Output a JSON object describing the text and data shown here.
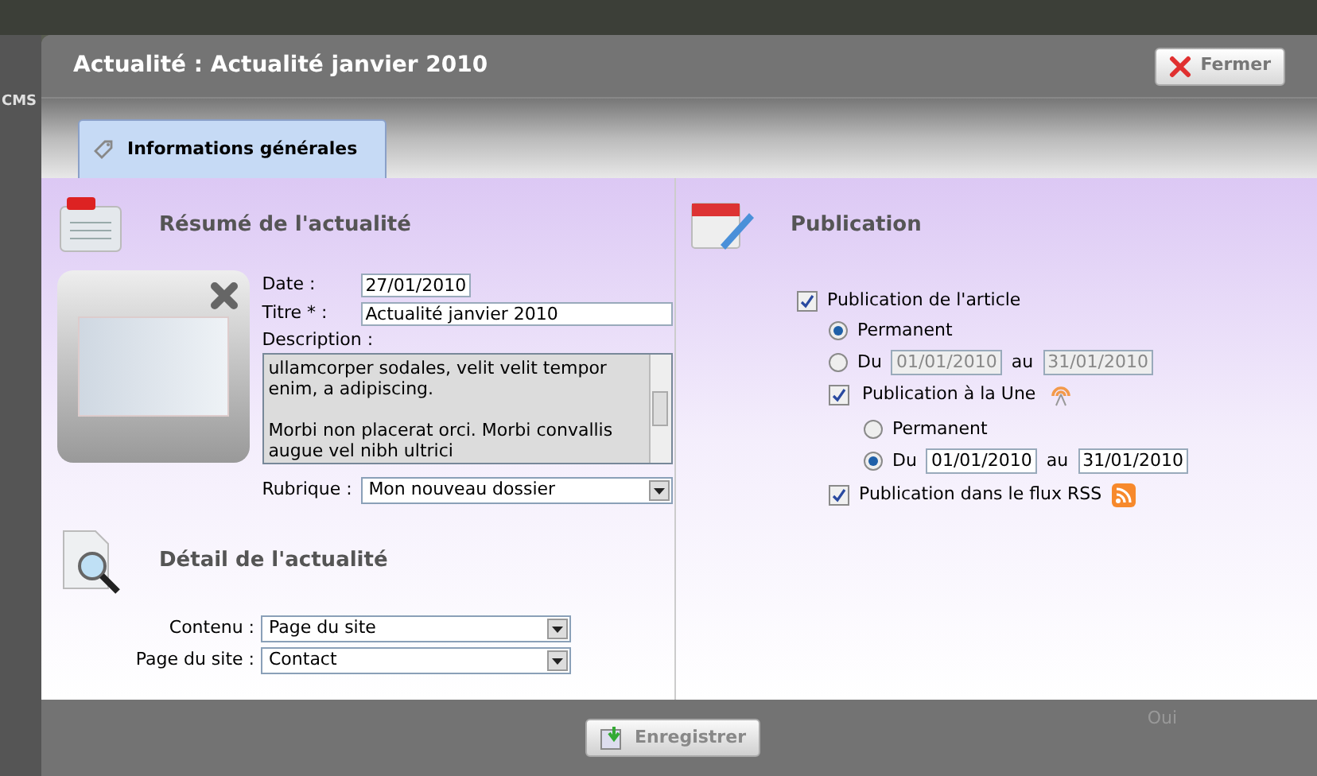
{
  "background": {
    "section_label": "CMS",
    "cell_text": "Oui"
  },
  "dialog": {
    "title": "Actualité : Actualité janvier 2010",
    "close_button": "Fermer"
  },
  "tabs": [
    {
      "label": "Informations générales",
      "selected": true
    }
  ],
  "summary": {
    "heading": "Résumé de l'actualité",
    "date": {
      "label": "Date :",
      "value": "27/01/2010"
    },
    "title": {
      "label": "Titre * :",
      "value": "Actualité janvier 2010"
    },
    "description": {
      "label": "Description :",
      "paragraphs": [
        [
          "ullamcorper sodales, velit velit tempor",
          "enim, a adipiscing."
        ],
        [
          "Morbi non placerat orci. Morbi convallis",
          "augue vel nibh ultrici"
        ]
      ]
    },
    "rubrique": {
      "label": "Rubrique :",
      "value": "Mon nouveau dossier"
    }
  },
  "detail": {
    "heading": "Détail de l'actualité",
    "fields": [
      {
        "label": "Contenu :",
        "value": "Page du site"
      },
      {
        "label": "Page du site :",
        "value": "Contact"
      }
    ]
  },
  "publication": {
    "heading": "Publication",
    "article": {
      "label": "Publication de l'article",
      "checked": true,
      "options": [
        {
          "kind": "permanent",
          "label": "Permanent",
          "selected": true
        },
        {
          "kind": "range",
          "label": "Du",
          "from": "01/01/2010",
          "sep": "au",
          "to": "31/01/2010",
          "selected": false
        }
      ]
    },
    "une": {
      "label": "Publication à la Une",
      "checked": true,
      "options": [
        {
          "kind": "permanent",
          "label": "Permanent",
          "selected": false
        },
        {
          "kind": "range",
          "label": "Du",
          "from": "01/01/2010",
          "sep": "au",
          "to": "31/01/2010",
          "selected": true
        }
      ]
    },
    "rss": {
      "label": "Publication dans le flux RSS",
      "checked": true
    }
  },
  "footer": {
    "save_button": "Enregistrer"
  }
}
